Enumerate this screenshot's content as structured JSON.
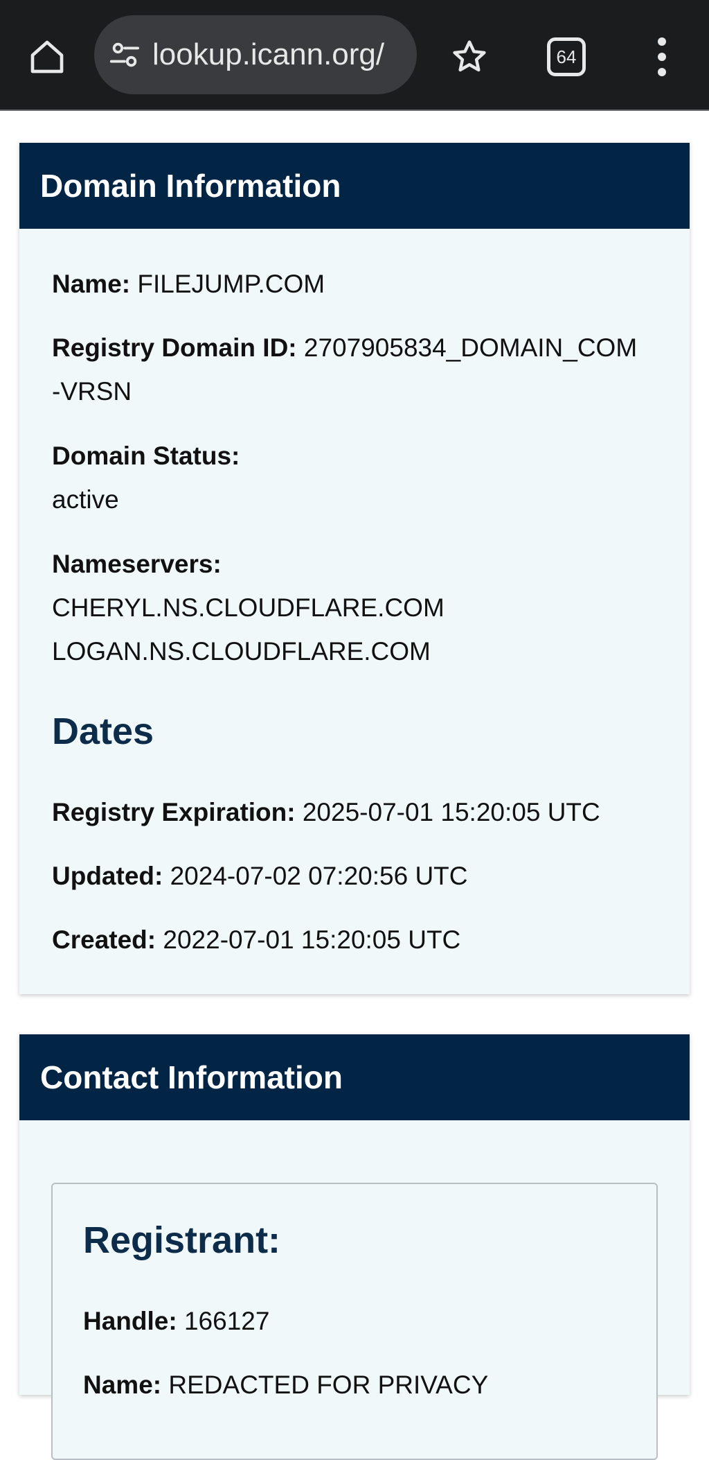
{
  "browser": {
    "url": "lookup.icann.org/",
    "tab_count": "64"
  },
  "domain_info": {
    "header": "Domain Information",
    "name_label": "Name:",
    "name_value": "FILEJUMP.COM",
    "registry_id_label": "Registry Domain ID:",
    "registry_id_value_line1": "2707905834_DOMAIN_COM",
    "registry_id_value_line2": "-VRSN",
    "status_label": "Domain Status:",
    "status_value": "active",
    "nameservers_label": "Nameservers:",
    "nameservers": [
      "CHERYL.NS.CLOUDFLARE.COM",
      "LOGAN.NS.CLOUDFLARE.COM"
    ],
    "dates_title": "Dates",
    "expiration_label": "Registry Expiration:",
    "expiration_value": "2025-07-01 15:20:05 UTC",
    "updated_label": "Updated:",
    "updated_value": "2024-07-02 07:20:56 UTC",
    "created_label": "Created:",
    "created_value": "2022-07-01 15:20:05 UTC"
  },
  "contact_info": {
    "header": "Contact Information",
    "registrant_title": "Registrant:",
    "handle_label": "Handle:",
    "handle_value": "166127",
    "name_label": "Name:",
    "name_value": "REDACTED FOR PRIVACY"
  },
  "colors": {
    "header_bg": "#022546",
    "card_bg": "#f0f8f9",
    "title_color": "#0d2c4a",
    "browser_bg": "#1b1c1e"
  }
}
